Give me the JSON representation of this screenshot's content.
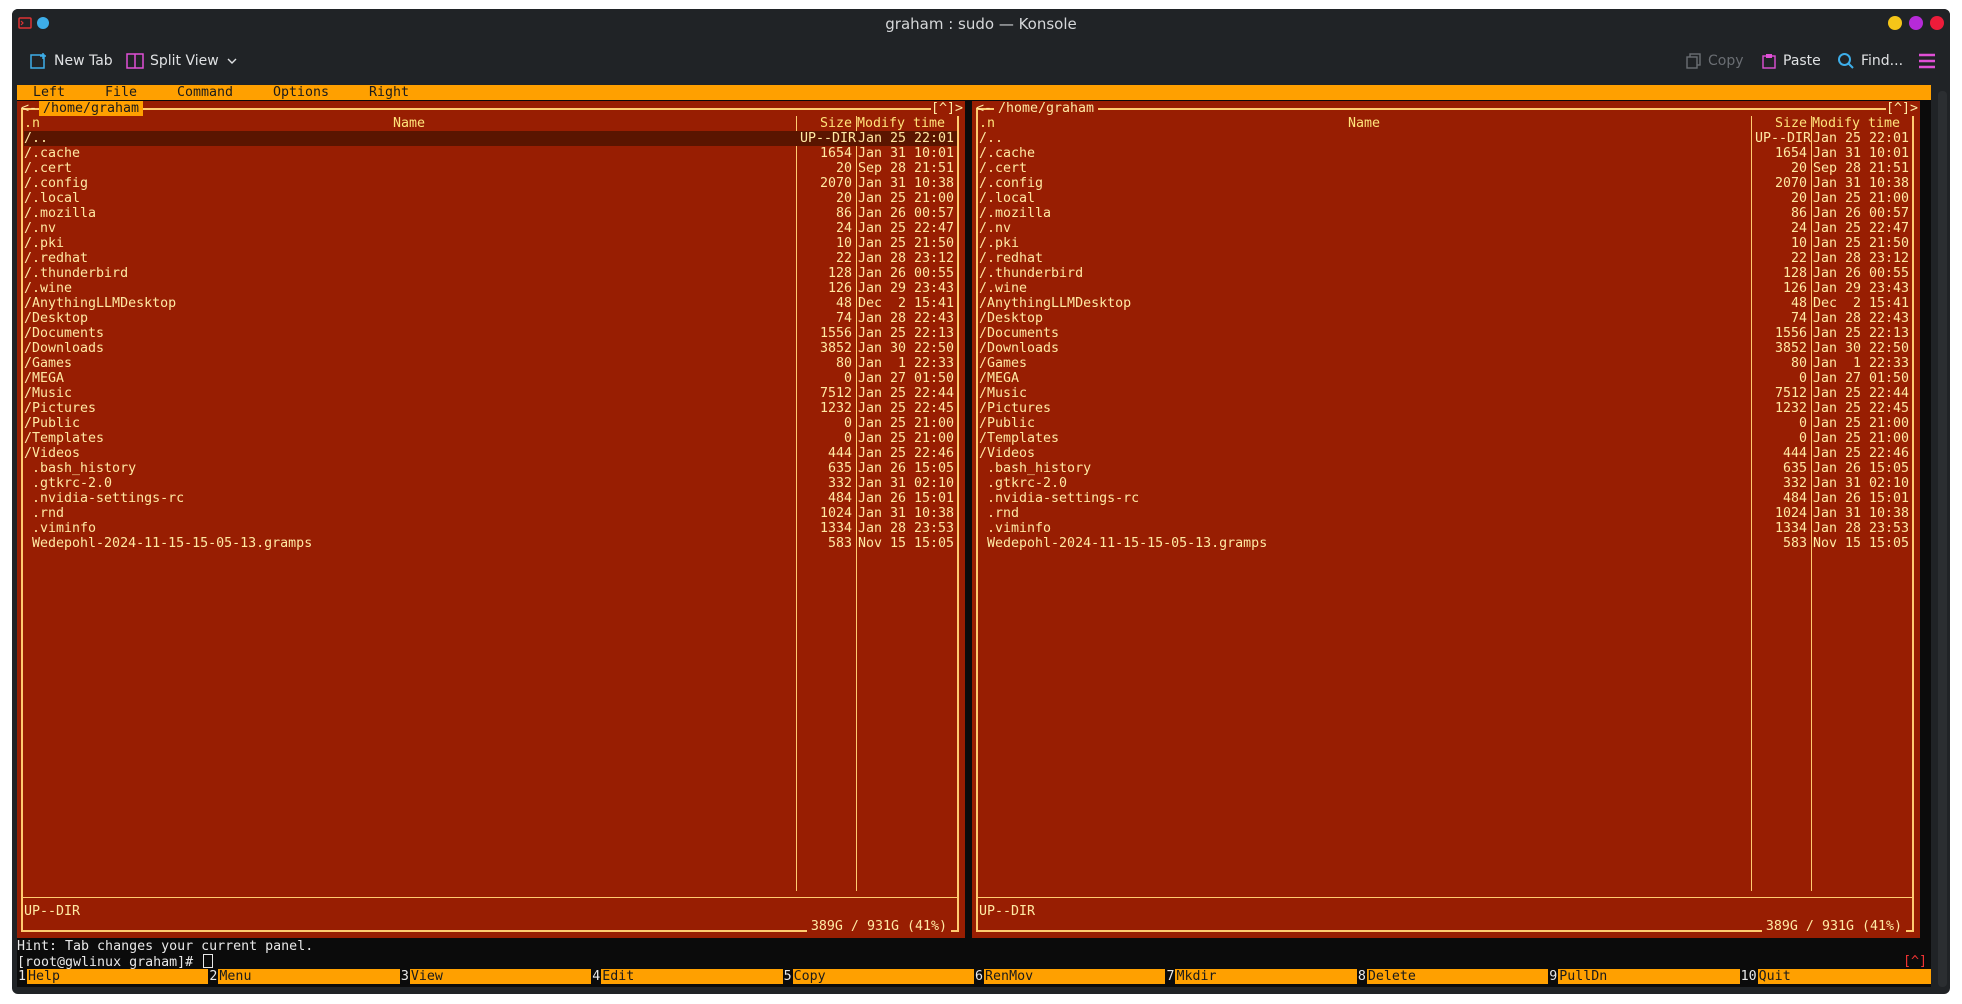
{
  "window": {
    "title": "graham : sudo — Konsole",
    "controls": [
      "minimize",
      "maximize",
      "close"
    ],
    "colors": {
      "minimize": "#f5c518",
      "maximize": "#b62ad9",
      "close": "#ed1c3a"
    }
  },
  "toolbar": {
    "new_tab": "New Tab",
    "split_view": "Split View",
    "copy": "Copy",
    "paste": "Paste",
    "find": "Find..."
  },
  "mc": {
    "menu": [
      "Left",
      "File",
      "Command",
      "Options",
      "Right"
    ],
    "left_panel": {
      "path": "/home/graham",
      "corner": "[^]>",
      "left_marker": "<-",
      "status": "UP--DIR",
      "disk": "389G / 931G (41%)"
    },
    "right_panel": {
      "path": "/home/graham",
      "corner": "[^]>",
      "left_marker": "<-",
      "status": "UP--DIR",
      "disk": "389G / 931G (41%)"
    },
    "headers": {
      "sort": ".n",
      "name": "Name",
      "size": "Size",
      "time": "Modify time"
    },
    "files": [
      {
        "name": "/..",
        "size": "UP--DIR",
        "time": "Jan 25 22:01"
      },
      {
        "name": "/.cache",
        "size": "1654",
        "time": "Jan 31 10:01"
      },
      {
        "name": "/.cert",
        "size": "20",
        "time": "Sep 28 21:51"
      },
      {
        "name": "/.config",
        "size": "2070",
        "time": "Jan 31 10:38"
      },
      {
        "name": "/.local",
        "size": "20",
        "time": "Jan 25 21:00"
      },
      {
        "name": "/.mozilla",
        "size": "86",
        "time": "Jan 26 00:57"
      },
      {
        "name": "/.nv",
        "size": "24",
        "time": "Jan 25 22:47"
      },
      {
        "name": "/.pki",
        "size": "10",
        "time": "Jan 25 21:50"
      },
      {
        "name": "/.redhat",
        "size": "22",
        "time": "Jan 28 23:12"
      },
      {
        "name": "/.thunderbird",
        "size": "128",
        "time": "Jan 26 00:55"
      },
      {
        "name": "/.wine",
        "size": "126",
        "time": "Jan 29 23:43"
      },
      {
        "name": "/AnythingLLMDesktop",
        "size": "48",
        "time": "Dec  2 15:41"
      },
      {
        "name": "/Desktop",
        "size": "74",
        "time": "Jan 28 22:43"
      },
      {
        "name": "/Documents",
        "size": "1556",
        "time": "Jan 25 22:13"
      },
      {
        "name": "/Downloads",
        "size": "3852",
        "time": "Jan 30 22:50"
      },
      {
        "name": "/Games",
        "size": "80",
        "time": "Jan  1 22:33"
      },
      {
        "name": "/MEGA",
        "size": "0",
        "time": "Jan 27 01:50"
      },
      {
        "name": "/Music",
        "size": "7512",
        "time": "Jan 25 22:44"
      },
      {
        "name": "/Pictures",
        "size": "1232",
        "time": "Jan 25 22:45"
      },
      {
        "name": "/Public",
        "size": "0",
        "time": "Jan 25 21:00"
      },
      {
        "name": "/Templates",
        "size": "0",
        "time": "Jan 25 21:00"
      },
      {
        "name": "/Videos",
        "size": "444",
        "time": "Jan 25 22:46"
      },
      {
        "name": " .bash_history",
        "size": "635",
        "time": "Jan 26 15:05"
      },
      {
        "name": " .gtkrc-2.0",
        "size": "332",
        "time": "Jan 31 02:10"
      },
      {
        "name": " .nvidia-settings-rc",
        "size": "484",
        "time": "Jan 26 15:01"
      },
      {
        "name": " .rnd",
        "size": "1024",
        "time": "Jan 31 10:38"
      },
      {
        "name": " .viminfo",
        "size": "1334",
        "time": "Jan 28 23:53"
      },
      {
        "name": " Wedepohl-2024-11-15-15-05-13.gramps",
        "size": "583",
        "time": "Nov 15 15:05"
      }
    ],
    "hint": "Hint: Tab changes your current panel.",
    "prompt": "[root@gwlinux graham]# ",
    "caret": "[^]",
    "fkeys": [
      {
        "num": "1",
        "label": "Help"
      },
      {
        "num": "2",
        "label": "Menu"
      },
      {
        "num": "3",
        "label": "View"
      },
      {
        "num": "4",
        "label": "Edit"
      },
      {
        "num": "5",
        "label": "Copy"
      },
      {
        "num": "6",
        "label": "RenMov"
      },
      {
        "num": "7",
        "label": "Mkdir"
      },
      {
        "num": "8",
        "label": "Delete"
      },
      {
        "num": "9",
        "label": "PullDn"
      },
      {
        "num": "10",
        "label": "Quit"
      }
    ]
  }
}
